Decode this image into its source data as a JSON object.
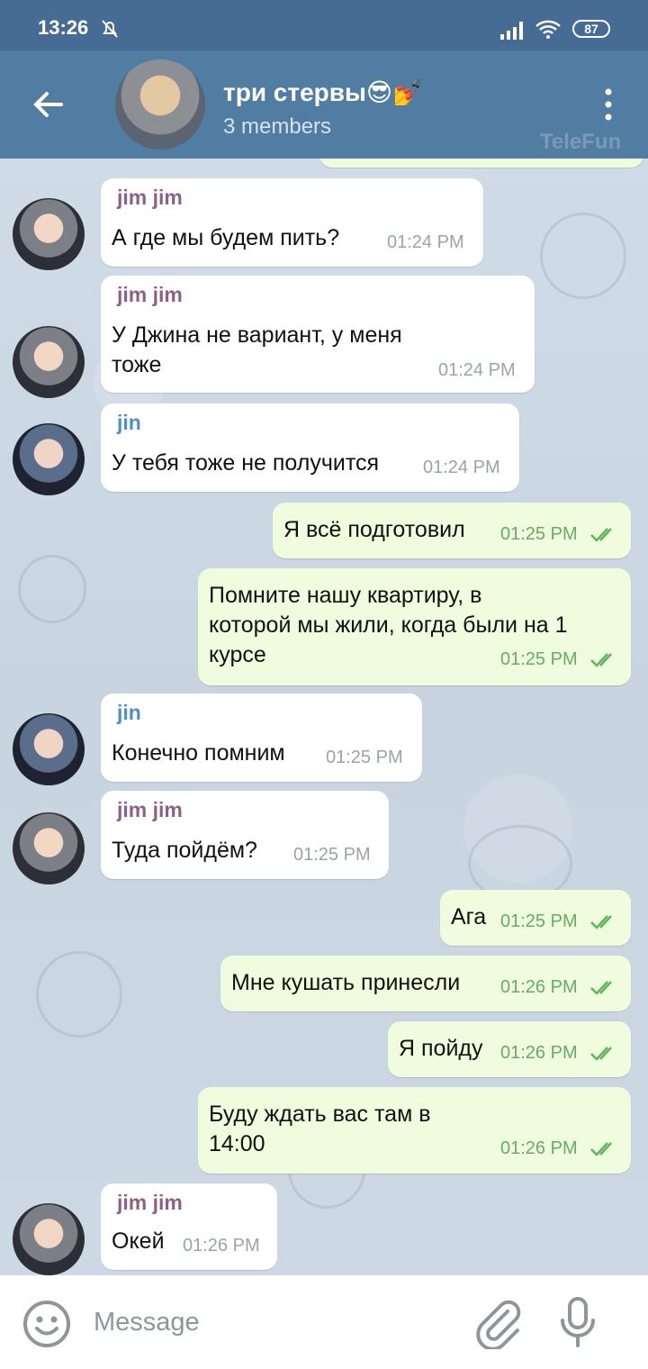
{
  "status_bar": {
    "time": "13:26",
    "battery": "87"
  },
  "header": {
    "title": "три стервы😎💅",
    "subtitle": "3 members",
    "watermark": "TeleFun"
  },
  "messages": [
    {
      "direction": "in",
      "sender": "jim jim",
      "lines": [
        "А где мы будем пить?"
      ],
      "time": "01:24 PM"
    },
    {
      "direction": "in",
      "sender": "jim jim",
      "lines": [
        "У Джина не вариант, у меня",
        "тоже"
      ],
      "time": "01:24 PM"
    },
    {
      "direction": "in",
      "sender": "jin",
      "lines": [
        "У тебя тоже не получится"
      ],
      "time": "01:24 PM"
    },
    {
      "direction": "out",
      "lines": [
        "Я всё подготовил"
      ],
      "time": "01:25 PM"
    },
    {
      "direction": "out",
      "lines": [
        "Помните нашу квартиру, в",
        "которой мы жили, когда были на 1",
        "курсе"
      ],
      "time": "01:25 PM"
    },
    {
      "direction": "in",
      "sender": "jin",
      "lines": [
        "Конечно помним"
      ],
      "time": "01:25 PM"
    },
    {
      "direction": "in",
      "sender": "jim jim",
      "lines": [
        "Туда пойдём?"
      ],
      "time": "01:25 PM"
    },
    {
      "direction": "out",
      "lines": [
        "Ага"
      ],
      "time": "01:25 PM"
    },
    {
      "direction": "out",
      "lines": [
        "Мне кушать принесли"
      ],
      "time": "01:26 PM"
    },
    {
      "direction": "out",
      "lines": [
        "Я пойду"
      ],
      "time": "01:26 PM"
    },
    {
      "direction": "out",
      "lines": [
        "Буду ждать вас там в",
        "14:00"
      ],
      "time": "01:26 PM"
    },
    {
      "direction": "in",
      "sender": "jim jim",
      "lines": [
        "Окей"
      ],
      "time": "01:26 PM"
    }
  ],
  "input": {
    "placeholder": "Message"
  },
  "colors": {
    "header": "#527da3",
    "status_bar": "#466c96",
    "outgoing_bubble": "#effdde",
    "incoming_bubble": "#ffffff",
    "sender_jimjim": "#8e5f87",
    "sender_jin": "#4f8fc9",
    "read_ticks": "#5fb55a"
  },
  "icons": [
    "back-arrow-icon",
    "more-vertical-icon",
    "mute-bell-icon",
    "signal-icon",
    "wifi-icon",
    "smile-icon",
    "paperclip-icon",
    "microphone-icon",
    "double-check-icon"
  ]
}
